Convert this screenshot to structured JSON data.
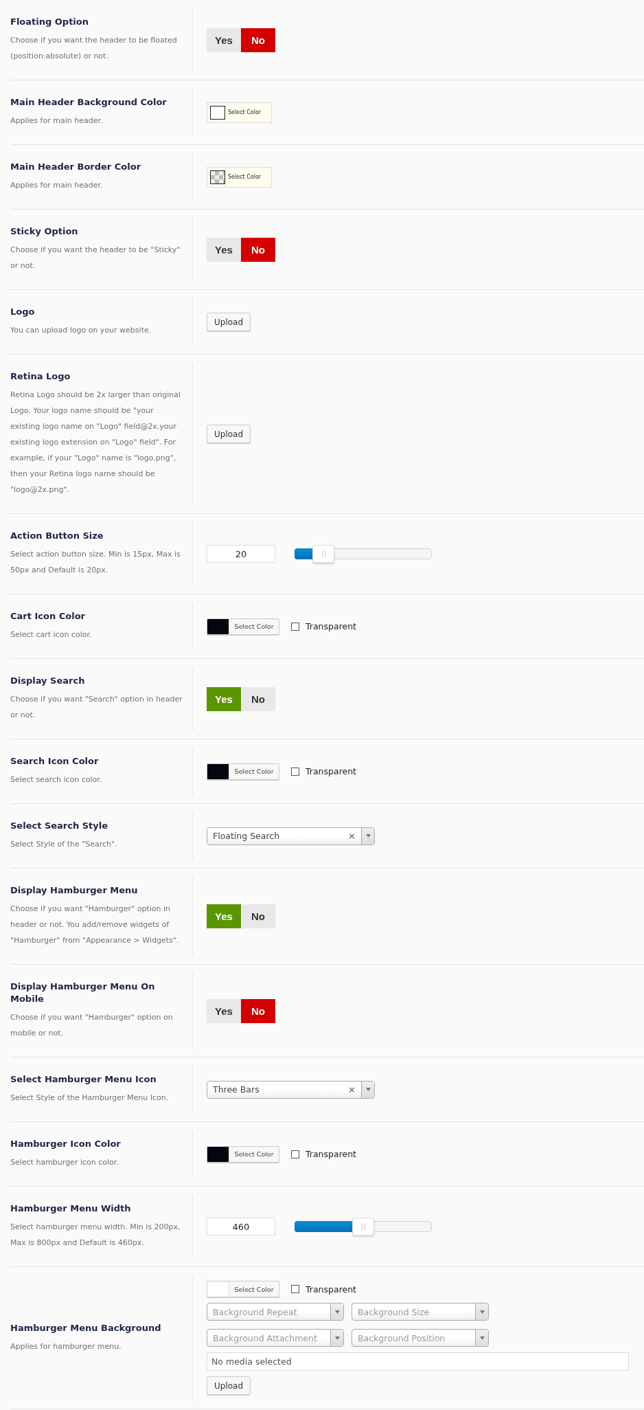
{
  "options": [
    {
      "kind": "toggle",
      "title": "Floating Option",
      "description": "Choose if you want the header to be floated (position:absolute) or not.",
      "options": [
        {
          "label": "Yes",
          "selected": false
        },
        {
          "label": "No",
          "selected": true
        }
      ]
    },
    {
      "kind": "swatch",
      "title": "Main Header Background Color",
      "description": "Applies for main header.",
      "button": "Select Color",
      "color": "#ffffff",
      "transparent": false
    },
    {
      "kind": "swatch",
      "title": "Main Header Border Color",
      "description": "Applies for main header.",
      "button": "Select Color",
      "transparent": true
    },
    {
      "kind": "toggle",
      "title": "Sticky Option",
      "description": "Choose if you want the header to be \"Sticky\" or not.",
      "options": [
        {
          "label": "Yes",
          "selected": false
        },
        {
          "label": "No",
          "selected": true
        }
      ]
    },
    {
      "kind": "upload",
      "title": "Logo",
      "description": "You can upload logo on your website.",
      "button": "Upload"
    },
    {
      "kind": "upload",
      "title": "Retina Logo",
      "description": "Retina Logo should be 2x larger than original Logo. Your logo name should be \"your existing logo name on \"Logo\" field@2x.your existing logo extension on \"Logo\" field\". For example, if your \"Logo\" name is \"logo.png\", then your Retina logo name should be \"logo@2x.png\".",
      "button": "Upload"
    },
    {
      "kind": "slider",
      "title": "Action Button Size",
      "description": "Select action button size. Min is 15px, Max is 50px and Default is 20px.",
      "value": "20",
      "level": 0.14
    },
    {
      "kind": "color",
      "title": "Cart Icon Color",
      "description": "Select cart icon color.",
      "button": "Select Color",
      "color": "#02060f",
      "transparent_label": "Transparent",
      "transparent": false
    },
    {
      "kind": "toggle",
      "title": "Display Search",
      "description": "Choose if you want \"Search\" option in header or not.",
      "options": [
        {
          "label": "Yes",
          "selected": true
        },
        {
          "label": "No",
          "selected": false
        }
      ]
    },
    {
      "kind": "color",
      "title": "Search Icon Color",
      "description": "Select search icon color.",
      "button": "Select Color",
      "color": "#02060f",
      "transparent_label": "Transparent",
      "transparent": false
    },
    {
      "kind": "select",
      "title": "Select Search Style",
      "description": "Select Style of the \"Search\".",
      "value": "Floating Search",
      "clear": "×"
    },
    {
      "kind": "toggle",
      "title": "Display Hamburger Menu",
      "description": "Choose if you want \"Hamburger\" option in header or not. You add/remove widgets of \"Hamburger\" from \"Appearance > Widgets\".",
      "options": [
        {
          "label": "Yes",
          "selected": true
        },
        {
          "label": "No",
          "selected": false
        }
      ]
    },
    {
      "kind": "toggle",
      "title": "Display Hamburger Menu On Mobile",
      "description": "Choose if you want \"Hamburger\" option on mobile or not.",
      "options": [
        {
          "label": "Yes",
          "selected": false
        },
        {
          "label": "No",
          "selected": true
        }
      ]
    },
    {
      "kind": "select",
      "title": "Select Hamburger Menu Icon",
      "description": "Select Style of the Hamburger Menu Icon.",
      "value": "Three Bars",
      "clear": "×"
    },
    {
      "kind": "color",
      "title": "Hamburger Icon Color",
      "description": "Select hamburger icon color.",
      "button": "Select Color",
      "color": "#02060f",
      "transparent_label": "Transparent",
      "transparent": false
    },
    {
      "kind": "slider",
      "title": "Hamburger Menu Width",
      "description": "Select hamburger menu width. Min is 200px, Max is 800px and Default is 460px.",
      "value": "460",
      "level": 0.43
    },
    {
      "kind": "background",
      "title": "Hamburger Menu Background",
      "description": "Applies for hamburger menu.",
      "button": "Select Color",
      "color": "#ffffff",
      "transparent_label": "Transparent",
      "transparent": false,
      "selects": [
        {
          "placeholder": "Background Repeat"
        },
        {
          "placeholder": "Background Size"
        },
        {
          "placeholder": "Background Attachment"
        },
        {
          "placeholder": "Background Position"
        }
      ],
      "media": "No media selected",
      "upload": "Upload"
    }
  ]
}
